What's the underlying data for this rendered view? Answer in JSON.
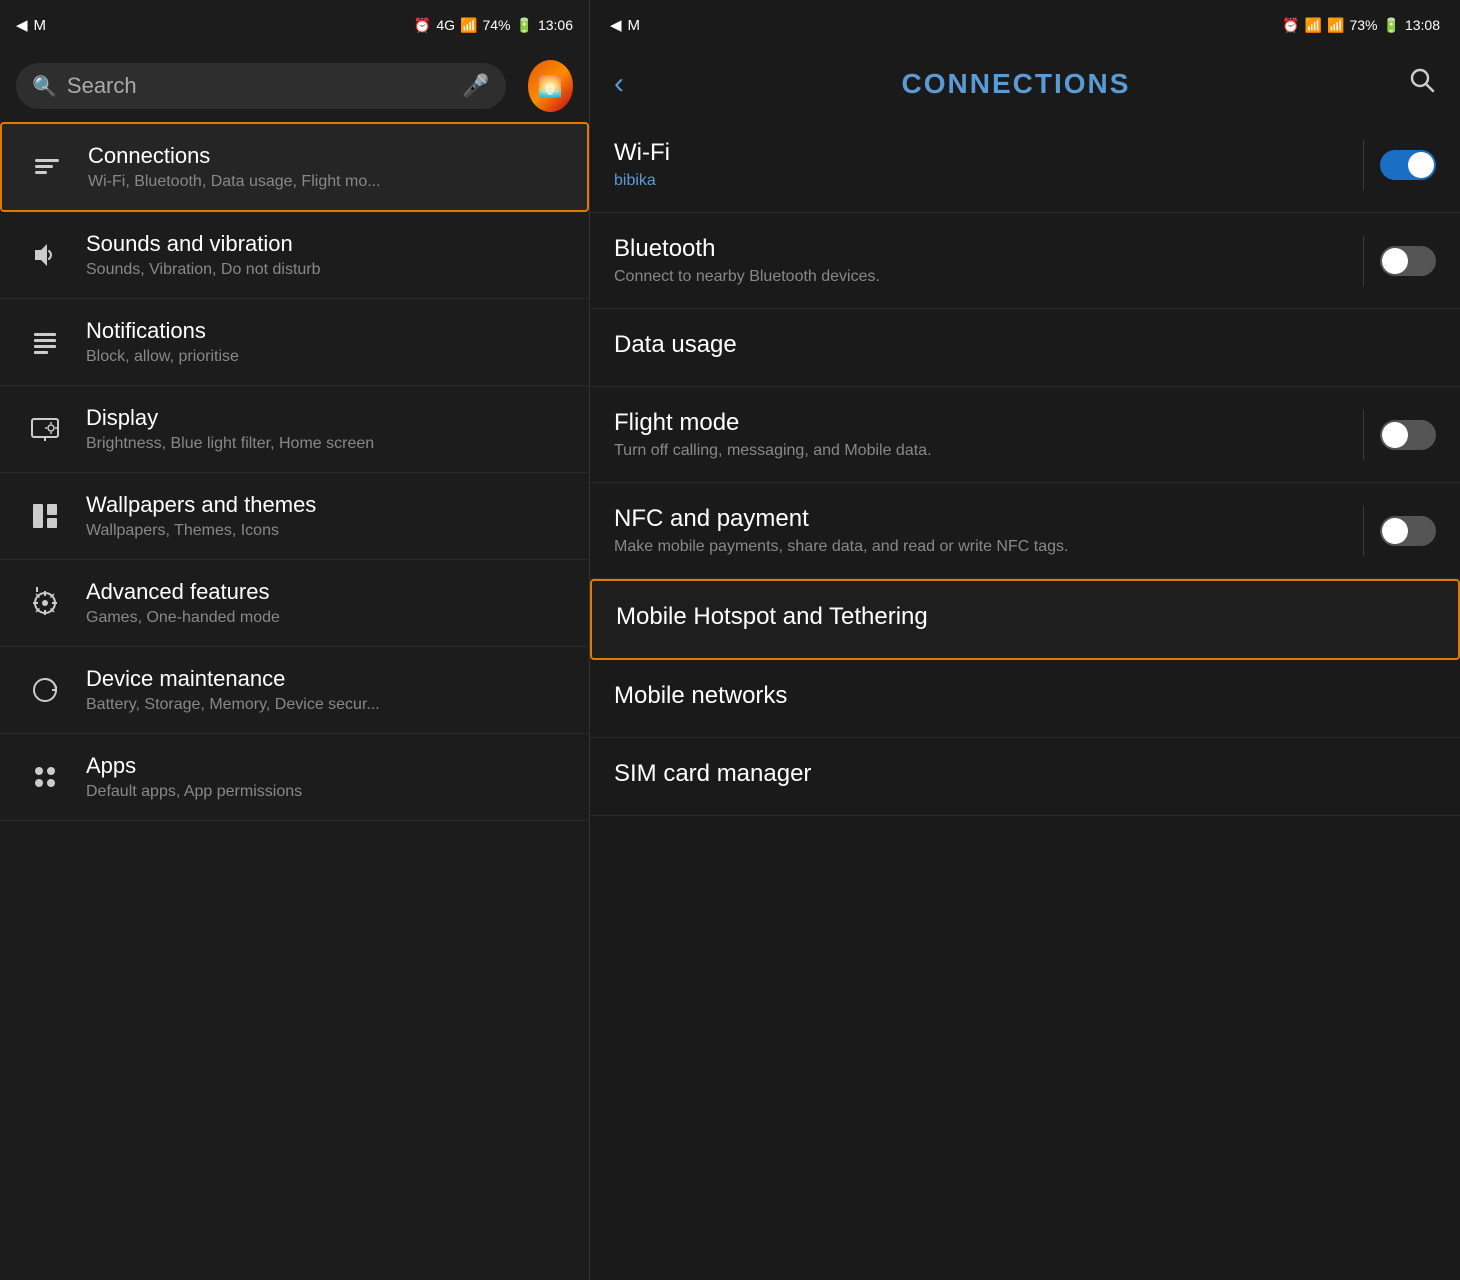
{
  "left": {
    "statusBar": {
      "left": "◀ M",
      "right_items": [
        "⏰",
        "4G",
        "📶",
        "74%",
        "🔋",
        "13:06"
      ]
    },
    "search": {
      "placeholder": "Search",
      "label": "Search"
    },
    "items": [
      {
        "id": "connections",
        "icon": "📡",
        "title": "Connections",
        "subtitle": "Wi-Fi, Bluetooth, Data usage, Flight mo...",
        "active": true
      },
      {
        "id": "sounds",
        "icon": "🔔",
        "title": "Sounds and vibration",
        "subtitle": "Sounds, Vibration, Do not disturb",
        "active": false
      },
      {
        "id": "notifications",
        "icon": "📋",
        "title": "Notifications",
        "subtitle": "Block, allow, prioritise",
        "active": false
      },
      {
        "id": "display",
        "icon": "🖥",
        "title": "Display",
        "subtitle": "Brightness, Blue light filter, Home screen",
        "active": false
      },
      {
        "id": "wallpapers",
        "icon": "🎨",
        "title": "Wallpapers and themes",
        "subtitle": "Wallpapers, Themes, Icons",
        "active": false
      },
      {
        "id": "advanced",
        "icon": "⚙",
        "title": "Advanced features",
        "subtitle": "Games, One-handed mode",
        "active": false
      },
      {
        "id": "maintenance",
        "icon": "🔄",
        "title": "Device maintenance",
        "subtitle": "Battery, Storage, Memory, Device secur...",
        "active": false
      },
      {
        "id": "apps",
        "icon": "⚏",
        "title": "Apps",
        "subtitle": "Default apps, App permissions",
        "active": false
      }
    ]
  },
  "right": {
    "statusBar": {
      "left": "◀ M",
      "right_items": [
        "⏰",
        "📶",
        "73%",
        "🔋",
        "13:08"
      ]
    },
    "header": {
      "back_label": "‹",
      "title": "CONNECTIONS",
      "search_label": "🔍"
    },
    "items": [
      {
        "id": "wifi",
        "title": "Wi-Fi",
        "subtitle": "bibika",
        "subtitle_color": "blue",
        "toggle": true,
        "toggle_state": "on",
        "highlighted": false
      },
      {
        "id": "bluetooth",
        "title": "Bluetooth",
        "subtitle": "Connect to nearby Bluetooth devices.",
        "subtitle_color": "gray",
        "toggle": true,
        "toggle_state": "off",
        "highlighted": false
      },
      {
        "id": "datausage",
        "title": "Data usage",
        "subtitle": "",
        "toggle": false,
        "highlighted": false
      },
      {
        "id": "flightmode",
        "title": "Flight mode",
        "subtitle": "Turn off calling, messaging, and Mobile data.",
        "subtitle_color": "gray",
        "toggle": true,
        "toggle_state": "off",
        "highlighted": false
      },
      {
        "id": "nfc",
        "title": "NFC and payment",
        "subtitle": "Make mobile payments, share data, and read or write NFC tags.",
        "subtitle_color": "gray",
        "toggle": true,
        "toggle_state": "off",
        "highlighted": false
      },
      {
        "id": "hotspot",
        "title": "Mobile Hotspot and Tethering",
        "subtitle": "",
        "toggle": false,
        "highlighted": true
      },
      {
        "id": "mobilenetworks",
        "title": "Mobile networks",
        "subtitle": "",
        "toggle": false,
        "highlighted": false
      },
      {
        "id": "simcard",
        "title": "SIM card manager",
        "subtitle": "",
        "toggle": false,
        "highlighted": false
      }
    ]
  }
}
